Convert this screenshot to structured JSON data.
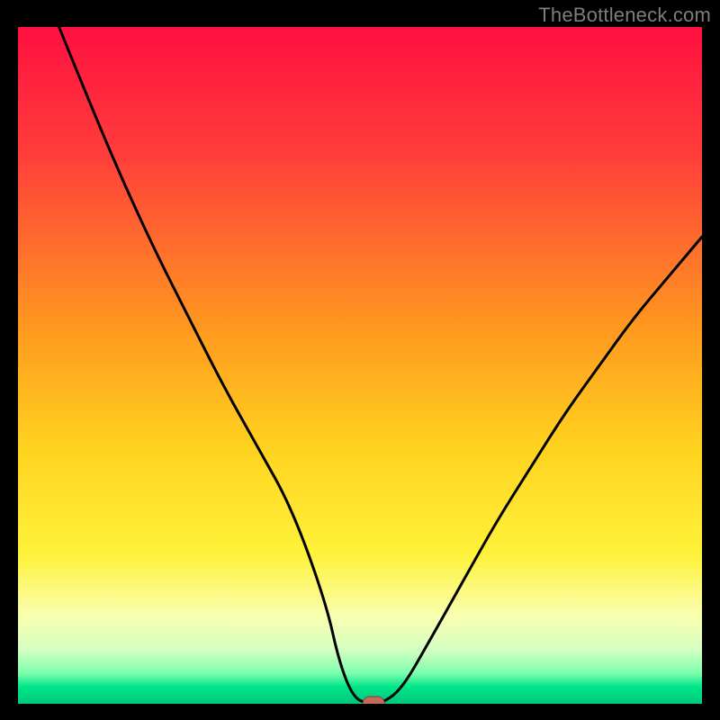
{
  "watermark": "TheBottleneck.com",
  "chart_data": {
    "type": "line",
    "title": "",
    "xlabel": "",
    "ylabel": "",
    "xlim": [
      0,
      100
    ],
    "ylim": [
      0,
      100
    ],
    "series": [
      {
        "name": "bottleneck-curve",
        "x": [
          6,
          10,
          15,
          20,
          25,
          30,
          35,
          40,
          45,
          47,
          49,
          51,
          53,
          56,
          60,
          65,
          70,
          75,
          80,
          85,
          90,
          95,
          100
        ],
        "values": [
          100,
          90,
          78,
          67,
          57,
          47,
          38,
          29,
          15,
          6,
          1,
          0,
          0,
          2,
          9,
          18,
          27,
          35,
          43,
          50,
          57,
          63,
          69
        ]
      }
    ],
    "marker": {
      "x": 52,
      "y": 0
    },
    "gradient_stops": [
      {
        "offset": 0.0,
        "color": "#ff1040"
      },
      {
        "offset": 0.18,
        "color": "#ff3b3b"
      },
      {
        "offset": 0.45,
        "color": "#ff9a1f"
      },
      {
        "offset": 0.62,
        "color": "#ffd21f"
      },
      {
        "offset": 0.78,
        "color": "#fff23a"
      },
      {
        "offset": 0.87,
        "color": "#f9ffb0"
      },
      {
        "offset": 0.92,
        "color": "#d5ffc2"
      },
      {
        "offset": 0.955,
        "color": "#7bffad"
      },
      {
        "offset": 0.975,
        "color": "#00e589"
      },
      {
        "offset": 1.0,
        "color": "#00c97a"
      }
    ]
  },
  "colors": {
    "frame": "#000000",
    "curve": "#000000",
    "marker_fill": "#c46a5e",
    "marker_stroke": "#8a3e36",
    "watermark": "#7d7d7d"
  }
}
